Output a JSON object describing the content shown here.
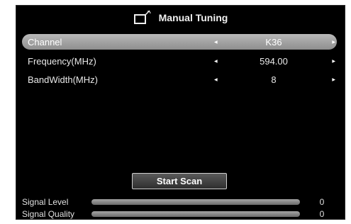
{
  "title": "Manual Tuning",
  "icon": "tv-antenna-icon",
  "rows": [
    {
      "label": "Channel",
      "value": "K36",
      "selected": true
    },
    {
      "label": "Frequency(MHz)",
      "value": "594.00",
      "selected": false
    },
    {
      "label": "BandWidth(MHz)",
      "value": "8",
      "selected": false
    }
  ],
  "start_scan_label": "Start Scan",
  "signal_level": {
    "label": "Signal Level",
    "value": "0",
    "fraction": 0
  },
  "signal_quality": {
    "label": "Signal Quality",
    "value": "0",
    "fraction": 0
  },
  "colors": {
    "selected_row": "#a3a3a3",
    "background": "#000000",
    "bar": "#8a8a8a"
  }
}
